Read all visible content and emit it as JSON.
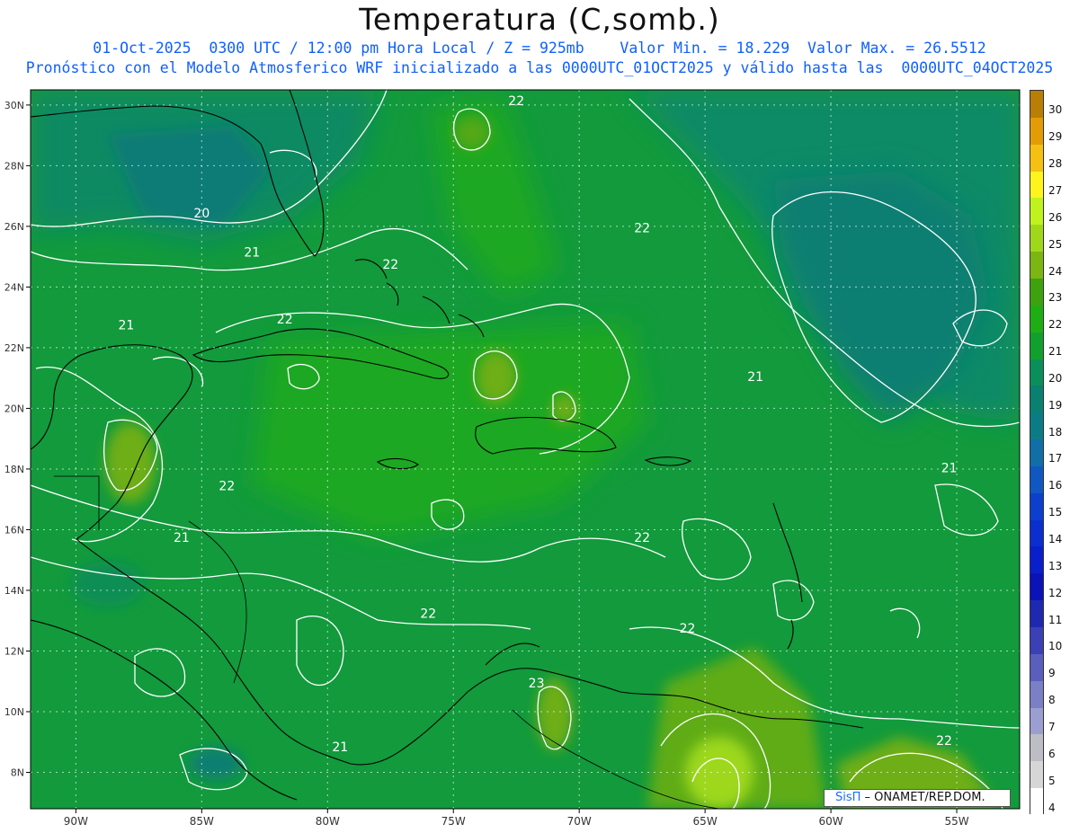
{
  "header": {
    "title": "Temperatura (C,somb.)",
    "subtitle_line1": "01-Oct-2025  0300 UTC / 12:00 pm Hora Local / Z = 925mb    Valor Min. = 18.229  Valor Max. = 26.5512",
    "subtitle_line2": "Pronóstico con el Modelo Atmosferico WRF inicializado a las 0000UTC_01OCT2025 y válido hasta las  0000UTC_04OCT2025"
  },
  "map": {
    "lon_ticks": [
      "90W",
      "85W",
      "80W",
      "75W",
      "70W",
      "65W",
      "60W",
      "55W"
    ],
    "lon_values": [
      -90,
      -85,
      -80,
      -75,
      -70,
      -65,
      -60,
      -55
    ],
    "lat_ticks": [
      "30N",
      "28N",
      "26N",
      "24N",
      "22N",
      "20N",
      "18N",
      "16N",
      "14N",
      "12N",
      "10N",
      "8N"
    ],
    "lat_values": [
      30,
      28,
      26,
      24,
      22,
      20,
      18,
      16,
      14,
      12,
      10,
      8
    ],
    "lon_range": [
      -91.8,
      -52.5
    ],
    "lat_range": [
      6.8,
      30.5
    ],
    "contour_labels": [
      {
        "text": "22",
        "lon": -72.5,
        "lat": 30.0
      },
      {
        "text": "20",
        "lon": -85.0,
        "lat": 26.3
      },
      {
        "text": "22",
        "lon": -67.5,
        "lat": 25.8
      },
      {
        "text": "21",
        "lon": -83.0,
        "lat": 25.0
      },
      {
        "text": "22",
        "lon": -77.5,
        "lat": 24.6
      },
      {
        "text": "22",
        "lon": -81.7,
        "lat": 22.8
      },
      {
        "text": "21",
        "lon": -88.0,
        "lat": 22.6
      },
      {
        "text": "21",
        "lon": -63.0,
        "lat": 20.9
      },
      {
        "text": "21",
        "lon": -55.3,
        "lat": 17.9
      },
      {
        "text": "22",
        "lon": -84.0,
        "lat": 17.3
      },
      {
        "text": "22",
        "lon": -67.5,
        "lat": 15.6
      },
      {
        "text": "21",
        "lon": -85.8,
        "lat": 15.6
      },
      {
        "text": "22",
        "lon": -76.0,
        "lat": 13.1
      },
      {
        "text": "22",
        "lon": -65.7,
        "lat": 12.6
      },
      {
        "text": "23",
        "lon": -71.7,
        "lat": 10.8
      },
      {
        "text": "22",
        "lon": -55.5,
        "lat": 8.9
      },
      {
        "text": "21",
        "lon": -79.5,
        "lat": 8.7
      }
    ]
  },
  "colorbar": {
    "labels": [
      "30",
      "29",
      "28",
      "27",
      "26",
      "25",
      "24",
      "23",
      "22",
      "21",
      "20",
      "19",
      "18",
      "17",
      "16",
      "15",
      "14",
      "13",
      "12",
      "11",
      "10",
      "9",
      "8",
      "7",
      "6",
      "5",
      "4"
    ],
    "colors": [
      "#b97e05",
      "#e39b06",
      "#f6c012",
      "#fff41c",
      "#c0f21e",
      "#9fd81a",
      "#7bb612",
      "#3ea20e",
      "#1eae14",
      "#11a02e",
      "#0a8f5a",
      "#0a8070",
      "#0b7c86",
      "#0f6fa6",
      "#1057c2",
      "#0d3fcf",
      "#0b2fcf",
      "#0a1fcc",
      "#0b12b8",
      "#1f29b0",
      "#3b40b5",
      "#5a5ebd",
      "#7a7fc6",
      "#9b9ed0",
      "#bdbdc5",
      "#d6d6d6",
      "#ffffff"
    ]
  },
  "credit": {
    "brand": "SisΠ",
    "text": " –  ONAMET/REP.DOM."
  }
}
